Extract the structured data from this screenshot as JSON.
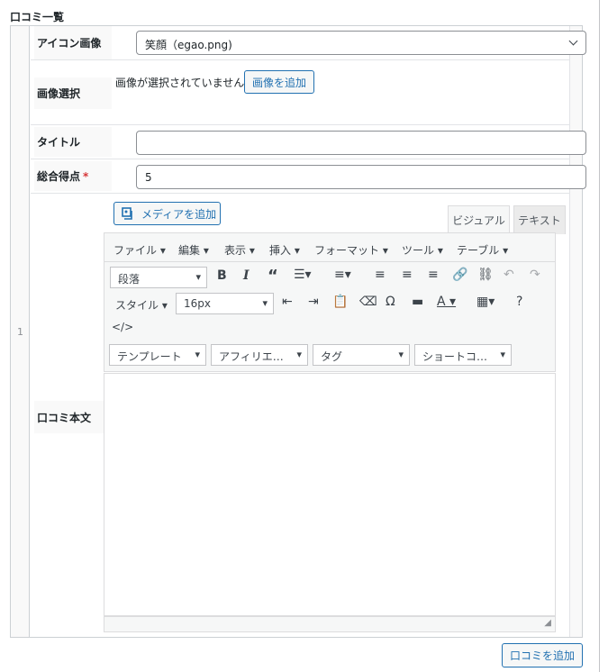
{
  "section_title": "口コミ一覧",
  "row_number": "1",
  "fields": {
    "icon_label": "アイコン画像",
    "icon_value": "笑顔（egao.png)",
    "image_label": "画像選択",
    "image_status": "画像が選択されていません",
    "add_image_button": "画像を追加",
    "title_label": "タイトル",
    "title_value": "",
    "score_label": "総合得点",
    "score_required": "*",
    "score_value": "5",
    "body_label": "口コミ本文"
  },
  "editor": {
    "add_media": "メディアを追加",
    "tab_visual": "ビジュアル",
    "tab_text": "テキスト",
    "menu": [
      "ファイル",
      "編集",
      "表示",
      "挿入",
      "フォーマット",
      "ツール",
      "テーブル"
    ],
    "paragraph": "段落",
    "style": "スタイル",
    "font_size": "16px",
    "template": "テンプレート",
    "affiliate": "アフィリエ…",
    "tag": "タグ",
    "shortcode": "ショートコ…"
  },
  "add_review_button": "口コミを追加"
}
